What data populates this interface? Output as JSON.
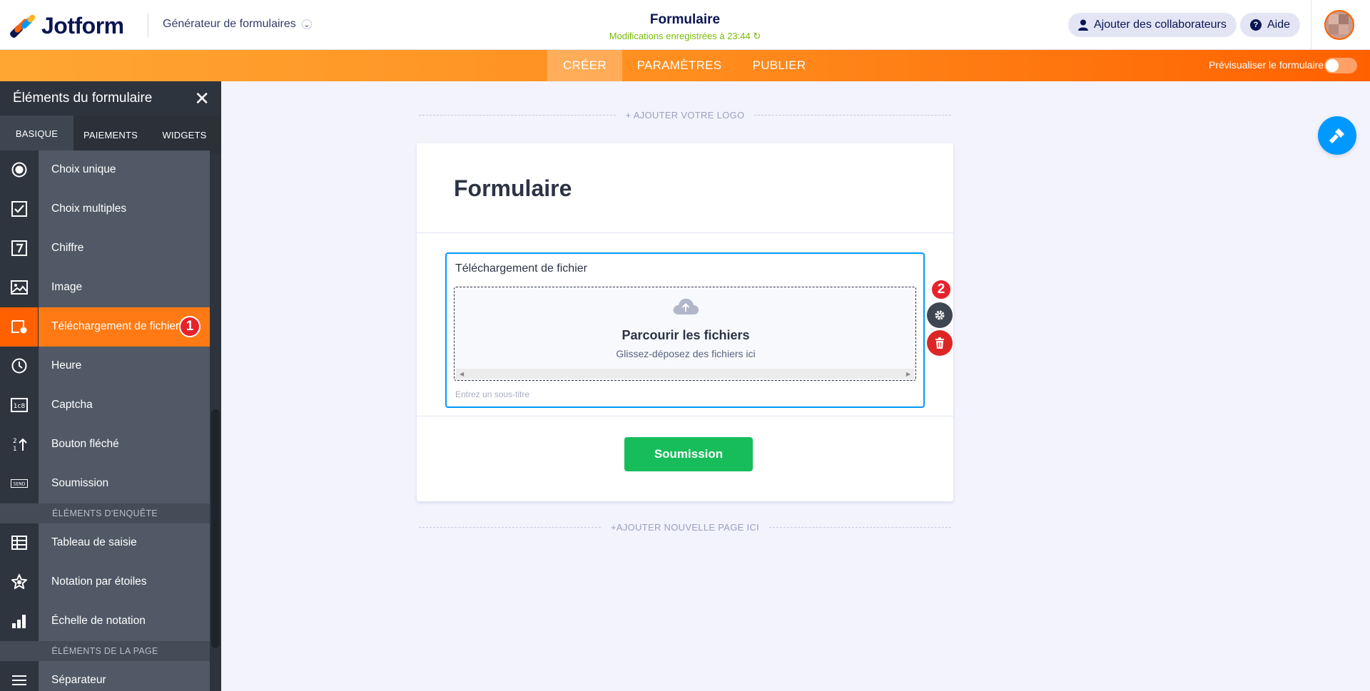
{
  "header": {
    "brand": "Jotform",
    "builder_select": "Générateur de formulaires",
    "form_title": "Formulaire",
    "saved_status": "Modifications enregistrées à 23:44 ↻",
    "collaborators_button": "Ajouter des collaborateurs",
    "help_button": "Aide"
  },
  "nav": {
    "tabs": [
      {
        "label": "CRÉER",
        "active": true
      },
      {
        "label": "PARAMÈTRES",
        "active": false
      },
      {
        "label": "PUBLIER",
        "active": false
      }
    ],
    "preview_label": "Prévisualiser le formulaire",
    "preview_enabled": false
  },
  "sidebar": {
    "title": "Éléments du formulaire",
    "tabs": [
      {
        "label": "BASIQUE",
        "active": true
      },
      {
        "label": "PAIEMENTS",
        "active": false
      },
      {
        "label": "WIDGETS",
        "active": false
      }
    ],
    "items": [
      {
        "label": "Choix unique",
        "icon": "radio-icon"
      },
      {
        "label": "Choix multiples",
        "icon": "checkbox-icon"
      },
      {
        "label": "Chiffre",
        "icon": "number-icon"
      },
      {
        "label": "Image",
        "icon": "image-icon"
      },
      {
        "label": "Téléchargement de fichier",
        "icon": "file-upload-icon",
        "active": true
      },
      {
        "label": "Heure",
        "icon": "clock-icon"
      },
      {
        "label": "Captcha",
        "icon": "captcha-icon"
      },
      {
        "label": "Bouton fléché",
        "icon": "spinner-icon"
      },
      {
        "label": "Soumission",
        "icon": "send-icon"
      }
    ],
    "section_survey": "ÉLÉMENTS D'ENQUÊTE",
    "survey_items": [
      {
        "label": "Tableau de saisie",
        "icon": "table-icon"
      },
      {
        "label": "Notation par étoiles",
        "icon": "star-icon"
      },
      {
        "label": "Échelle de notation",
        "icon": "bar-scale-icon"
      }
    ],
    "section_page": "ÉLÉMENTS DE LA PAGE",
    "page_items": [
      {
        "label": "Séparateur",
        "icon": "divider-icon"
      }
    ]
  },
  "annotations": {
    "badge_1": "1",
    "badge_2": "2"
  },
  "canvas": {
    "add_logo": "+ AJOUTER VOTRE LOGO",
    "add_page": "+AJOUTER NOUVELLE PAGE ICI",
    "form_heading": "Formulaire",
    "field_label": "Téléchargement de fichier",
    "drop_title": "Parcourir les fichiers",
    "drop_subtitle": "Glissez-déposez des fichiers ici",
    "subtitle_placeholder": "Entrez un sous-titre",
    "submit_label": "Soumission"
  },
  "colors": {
    "accent_orange": "#ff6100",
    "accent_blue": "#0099ff",
    "submit_green": "#18bd5b",
    "badge_red": "#e8222b"
  }
}
